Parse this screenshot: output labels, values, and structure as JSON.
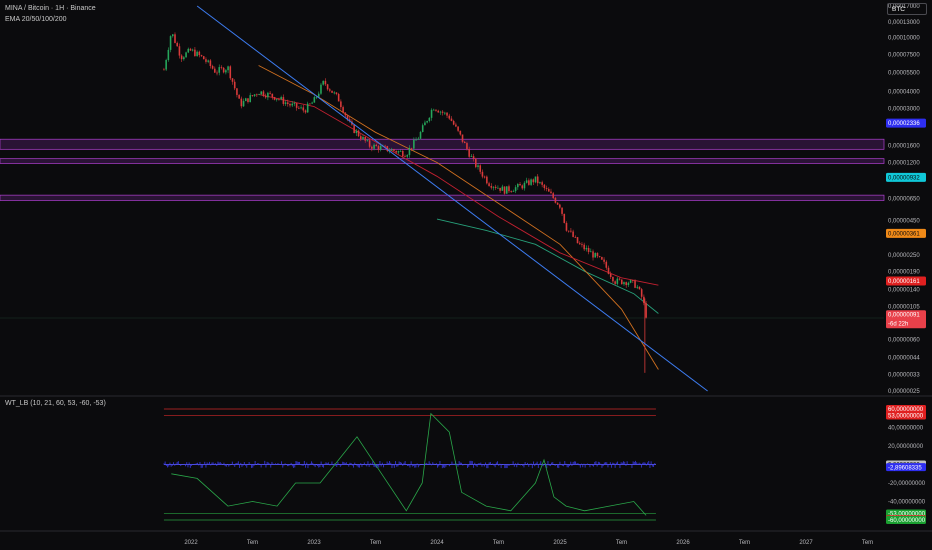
{
  "header": {
    "title": "MINA / Bitcoin · 1H · Binance",
    "indicator": "EMA 20/50/100/200",
    "oscillator": "WT_LB (10, 21, 60, 53, -60, -53)",
    "currency_badge": "BTC"
  },
  "chart_data": [
    {
      "type": "candlestick",
      "pair": "MINA / Bitcoin",
      "timeframe": "1H",
      "exchange": "Binance",
      "y_scale": "log",
      "y_tick_labels": [
        "0,00017000",
        "0,00013000",
        "0,00010000",
        "0,00007500",
        "0,00005500",
        "0,00004000",
        "0,00003000",
        "0,00001600",
        "0,00001200",
        "0,00000650",
        "0,00000450",
        "0,00000350",
        "0,00000250",
        "0,00000190",
        "0,00000140",
        "0,00000105",
        "0,00000060",
        "0,00000044",
        "0,00000033",
        "0,00000025"
      ],
      "x_tick_labels": [
        "2022",
        "Tem",
        "2023",
        "Tem",
        "2024",
        "Tem",
        "2025",
        "Tem",
        "2026",
        "Tem",
        "2027",
        "Tem"
      ],
      "price_path": [
        [
          2021.78,
          5.8e-05
        ],
        [
          2021.84,
          0.00011
        ],
        [
          2021.92,
          7.2e-05
        ],
        [
          2022.0,
          8e-05
        ],
        [
          2022.1,
          7e-05
        ],
        [
          2022.2,
          5.6e-05
        ],
        [
          2022.3,
          6e-05
        ],
        [
          2022.4,
          3.2e-05
        ],
        [
          2022.55,
          4e-05
        ],
        [
          2022.7,
          3.6e-05
        ],
        [
          2022.8,
          3.2e-05
        ],
        [
          2022.92,
          2.9e-05
        ],
        [
          2023.0,
          3.4e-05
        ],
        [
          2023.08,
          4.7e-05
        ],
        [
          2023.2,
          3.5e-05
        ],
        [
          2023.3,
          2.2e-05
        ],
        [
          2023.45,
          1.6e-05
        ],
        [
          2023.6,
          1.5e-05
        ],
        [
          2023.75,
          1.4e-05
        ],
        [
          2023.85,
          1.85e-05
        ],
        [
          2023.97,
          3.1e-05
        ],
        [
          2024.1,
          2.6e-05
        ],
        [
          2024.2,
          1.8e-05
        ],
        [
          2024.3,
          1.2e-05
        ],
        [
          2024.42,
          8.5e-06
        ],
        [
          2024.55,
          7.5e-06
        ],
        [
          2024.68,
          8e-06
        ],
        [
          2024.8,
          9e-06
        ],
        [
          2024.92,
          7e-06
        ],
        [
          2025.0,
          5.8e-06
        ],
        [
          2025.05,
          4e-06
        ],
        [
          2025.15,
          3e-06
        ],
        [
          2025.25,
          2.6e-06
        ],
        [
          2025.35,
          2.2e-06
        ],
        [
          2025.45,
          1.6e-06
        ],
        [
          2025.55,
          1.6e-06
        ],
        [
          2025.62,
          1.5e-06
        ],
        [
          2025.67,
          1.2e-06
        ],
        [
          2025.7,
          9.1e-07
        ]
      ],
      "ema_200": [
        [
          2024.0,
          4.6e-06
        ],
        [
          2024.4,
          3.8e-06
        ],
        [
          2024.8,
          3e-06
        ],
        [
          2025.2,
          1.9e-06
        ],
        [
          2025.6,
          1.3e-06
        ],
        [
          2025.8,
          9.3e-07
        ]
      ],
      "ema_100": [
        [
          2022.55,
          6.2e-05
        ],
        [
          2023.0,
          3.8e-05
        ],
        [
          2023.5,
          2e-05
        ],
        [
          2024.0,
          1.2e-05
        ],
        [
          2024.5,
          6e-06
        ],
        [
          2025.0,
          3e-06
        ],
        [
          2025.5,
          1e-06
        ],
        [
          2025.8,
          3.6e-07
        ]
      ],
      "ema_50": [
        [
          2022.55,
          3.8e-05
        ],
        [
          2023.0,
          3.1e-05
        ],
        [
          2023.5,
          1.7e-05
        ],
        [
          2024.0,
          9.5e-06
        ],
        [
          2024.5,
          4.8e-06
        ],
        [
          2025.0,
          2.6e-06
        ],
        [
          2025.5,
          1.7e-06
        ],
        [
          2025.8,
          1.5e-06
        ]
      ],
      "trendline": [
        [
          2022.05,
          0.00017
        ],
        [
          2026.2,
          2.5e-07
        ]
      ],
      "zones": [
        [
          1.78e-05,
          1.5e-05
        ],
        [
          1.28e-05,
          1.18e-05
        ],
        [
          6.9e-06,
          6.3e-06
        ]
      ],
      "price_badges": [
        {
          "label": "0,00002336",
          "color": "#2e2ef0",
          "text_color": "#ffffff"
        },
        {
          "label": "0,00000932",
          "color": "#10c8d8",
          "text_color": "#0b0b0d"
        },
        {
          "label": "0,00000361",
          "color": "#f08a18",
          "text_color": "#0b0b0d"
        },
        {
          "label": "0,00000161",
          "color": "#e02020",
          "text_color": "#ffffff"
        },
        {
          "label": "0,00000091",
          "sub": "-6d 22h",
          "color": "#e8404a",
          "text_color": "#ffffff"
        }
      ]
    },
    {
      "type": "line",
      "name": "WT_LB",
      "ylim": [
        -65,
        65
      ],
      "y_tick_labels": [
        "40,00000000",
        "20,00000000",
        "-20,00000000",
        "-40,00000000"
      ],
      "overbought": [
        60,
        53
      ],
      "oversold": [
        -53,
        -60
      ],
      "series": [
        {
          "color": "#2aa84a",
          "values": [
            [
              2021.84,
              -10
            ],
            [
              2022.05,
              -15
            ],
            [
              2022.3,
              -45
            ],
            [
              2022.5,
              -40
            ],
            [
              2022.7,
              -45
            ],
            [
              2022.85,
              -20
            ],
            [
              2023.05,
              -20
            ],
            [
              2023.2,
              5
            ],
            [
              2023.35,
              30
            ],
            [
              2023.55,
              -10
            ],
            [
              2023.75,
              -50
            ],
            [
              2023.88,
              -20
            ],
            [
              2023.95,
              55
            ],
            [
              2024.1,
              35
            ],
            [
              2024.2,
              -30
            ],
            [
              2024.4,
              -45
            ],
            [
              2024.6,
              -50
            ],
            [
              2024.8,
              -20
            ],
            [
              2024.87,
              5
            ],
            [
              2024.95,
              -35
            ],
            [
              2025.05,
              -45
            ],
            [
              2025.2,
              -50
            ],
            [
              2025.4,
              -45
            ],
            [
              2025.6,
              -40
            ],
            [
              2025.7,
              -55
            ]
          ]
        }
      ],
      "value_badges": [
        {
          "label": "60,00000000",
          "color": "#e02020",
          "text_color": "#ffffff"
        },
        {
          "label": "53,00000000",
          "color": "#e02020",
          "text_color": "#ffffff"
        },
        {
          "label": "0,00000000",
          "color": "#bfbfbf",
          "text_color": "#0b0b0d"
        },
        {
          "label": "-2,89608335",
          "color": "#2e2ef0",
          "text_color": "#ffffff"
        },
        {
          "label": "-53,00000000",
          "color": "#1aa030",
          "text_color": "#ffffff"
        },
        {
          "label": "-59,16832012",
          "color": "#e02020",
          "text_color": "#ffffff"
        },
        {
          "label": "-60,00000000",
          "color": "#1aa030",
          "text_color": "#ffffff"
        }
      ]
    }
  ]
}
